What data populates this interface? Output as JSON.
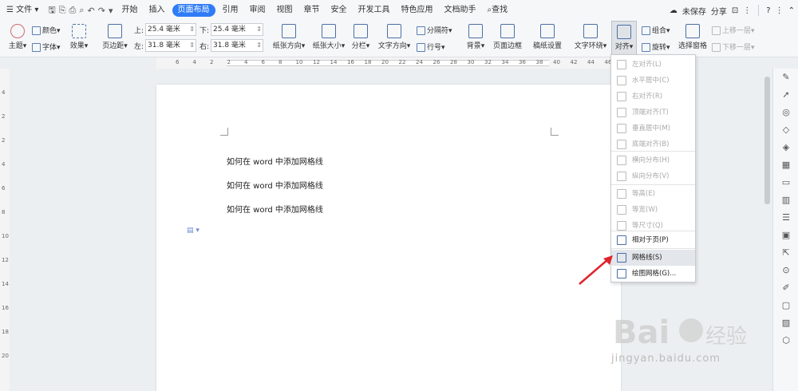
{
  "menubar": {
    "file_label": "文件",
    "tabs": [
      "开始",
      "插入",
      "页面布局",
      "引用",
      "审阅",
      "视图",
      "章节",
      "安全",
      "开发工具",
      "特色应用",
      "文档助手"
    ],
    "active_tab": "页面布局",
    "search_label": "查找",
    "unsaved_label": "未保存",
    "share_label": "分享",
    "help_icon": "?"
  },
  "ribbon": {
    "theme": "主题",
    "colors": "颜色",
    "fonts": "字体",
    "effects": "效果",
    "margins": "页边距",
    "top_label": "上:",
    "top_value": "25.4 毫米",
    "bottom_label": "下:",
    "bottom_value": "25.4 毫米",
    "left_label": "左:",
    "left_value": "31.8 毫米",
    "right_label": "右:",
    "right_value": "31.8 毫米",
    "orientation": "纸张方向",
    "size": "纸张大小",
    "columns": "分栏",
    "text_direction": "文字方向",
    "breaks": "分隔符",
    "line_numbers": "行号",
    "background": "背景",
    "page_border": "页面边框",
    "manuscript": "稿纸设置",
    "wrap_text": "文字环绕",
    "align": "对齐",
    "group": "组合",
    "rotate": "旋转",
    "selection_pane": "选择窗格",
    "bring_forward": "上移一层",
    "send_backward": "下移一层"
  },
  "ruler": {
    "labels": [
      "6",
      "4",
      "2",
      "2",
      "4",
      "6",
      "8",
      "10",
      "12",
      "14",
      "16",
      "18",
      "20",
      "22",
      "24",
      "26",
      "28",
      "30",
      "32",
      "34",
      "36",
      "38",
      "40",
      "42",
      "44",
      "46"
    ],
    "vertical_labels": [
      "4",
      "2",
      "2",
      "4",
      "6",
      "8",
      "10",
      "12",
      "14",
      "16",
      "18",
      "20"
    ]
  },
  "document": {
    "lines": [
      "如何在 word 中添加网格线",
      "如何在 word 中添加网格线",
      "如何在 word 中添加网格线"
    ]
  },
  "align_menu": {
    "items": [
      {
        "label": "左对齐(L)",
        "enabled": false
      },
      {
        "label": "水平居中(C)",
        "enabled": false
      },
      {
        "label": "右对齐(R)",
        "enabled": false
      },
      {
        "label": "顶端对齐(T)",
        "enabled": false
      },
      {
        "label": "垂直居中(M)",
        "enabled": false
      },
      {
        "label": "底端对齐(B)",
        "enabled": false
      },
      {
        "label": "横向分布(H)",
        "enabled": false
      },
      {
        "label": "纵向分布(V)",
        "enabled": false
      },
      {
        "label": "等高(E)",
        "enabled": false
      },
      {
        "label": "等宽(W)",
        "enabled": false
      },
      {
        "label": "等尺寸(Q)",
        "enabled": false
      },
      {
        "label": "相对于页(P)",
        "enabled": true
      },
      {
        "label": "网格线(S)",
        "enabled": true
      },
      {
        "label": "绘图网格(G)...",
        "enabled": true
      }
    ]
  },
  "watermark": {
    "text": "jingyan.baidu.com"
  },
  "colors": {
    "accent": "#2f7cf6",
    "arrow": "#e0242c"
  }
}
